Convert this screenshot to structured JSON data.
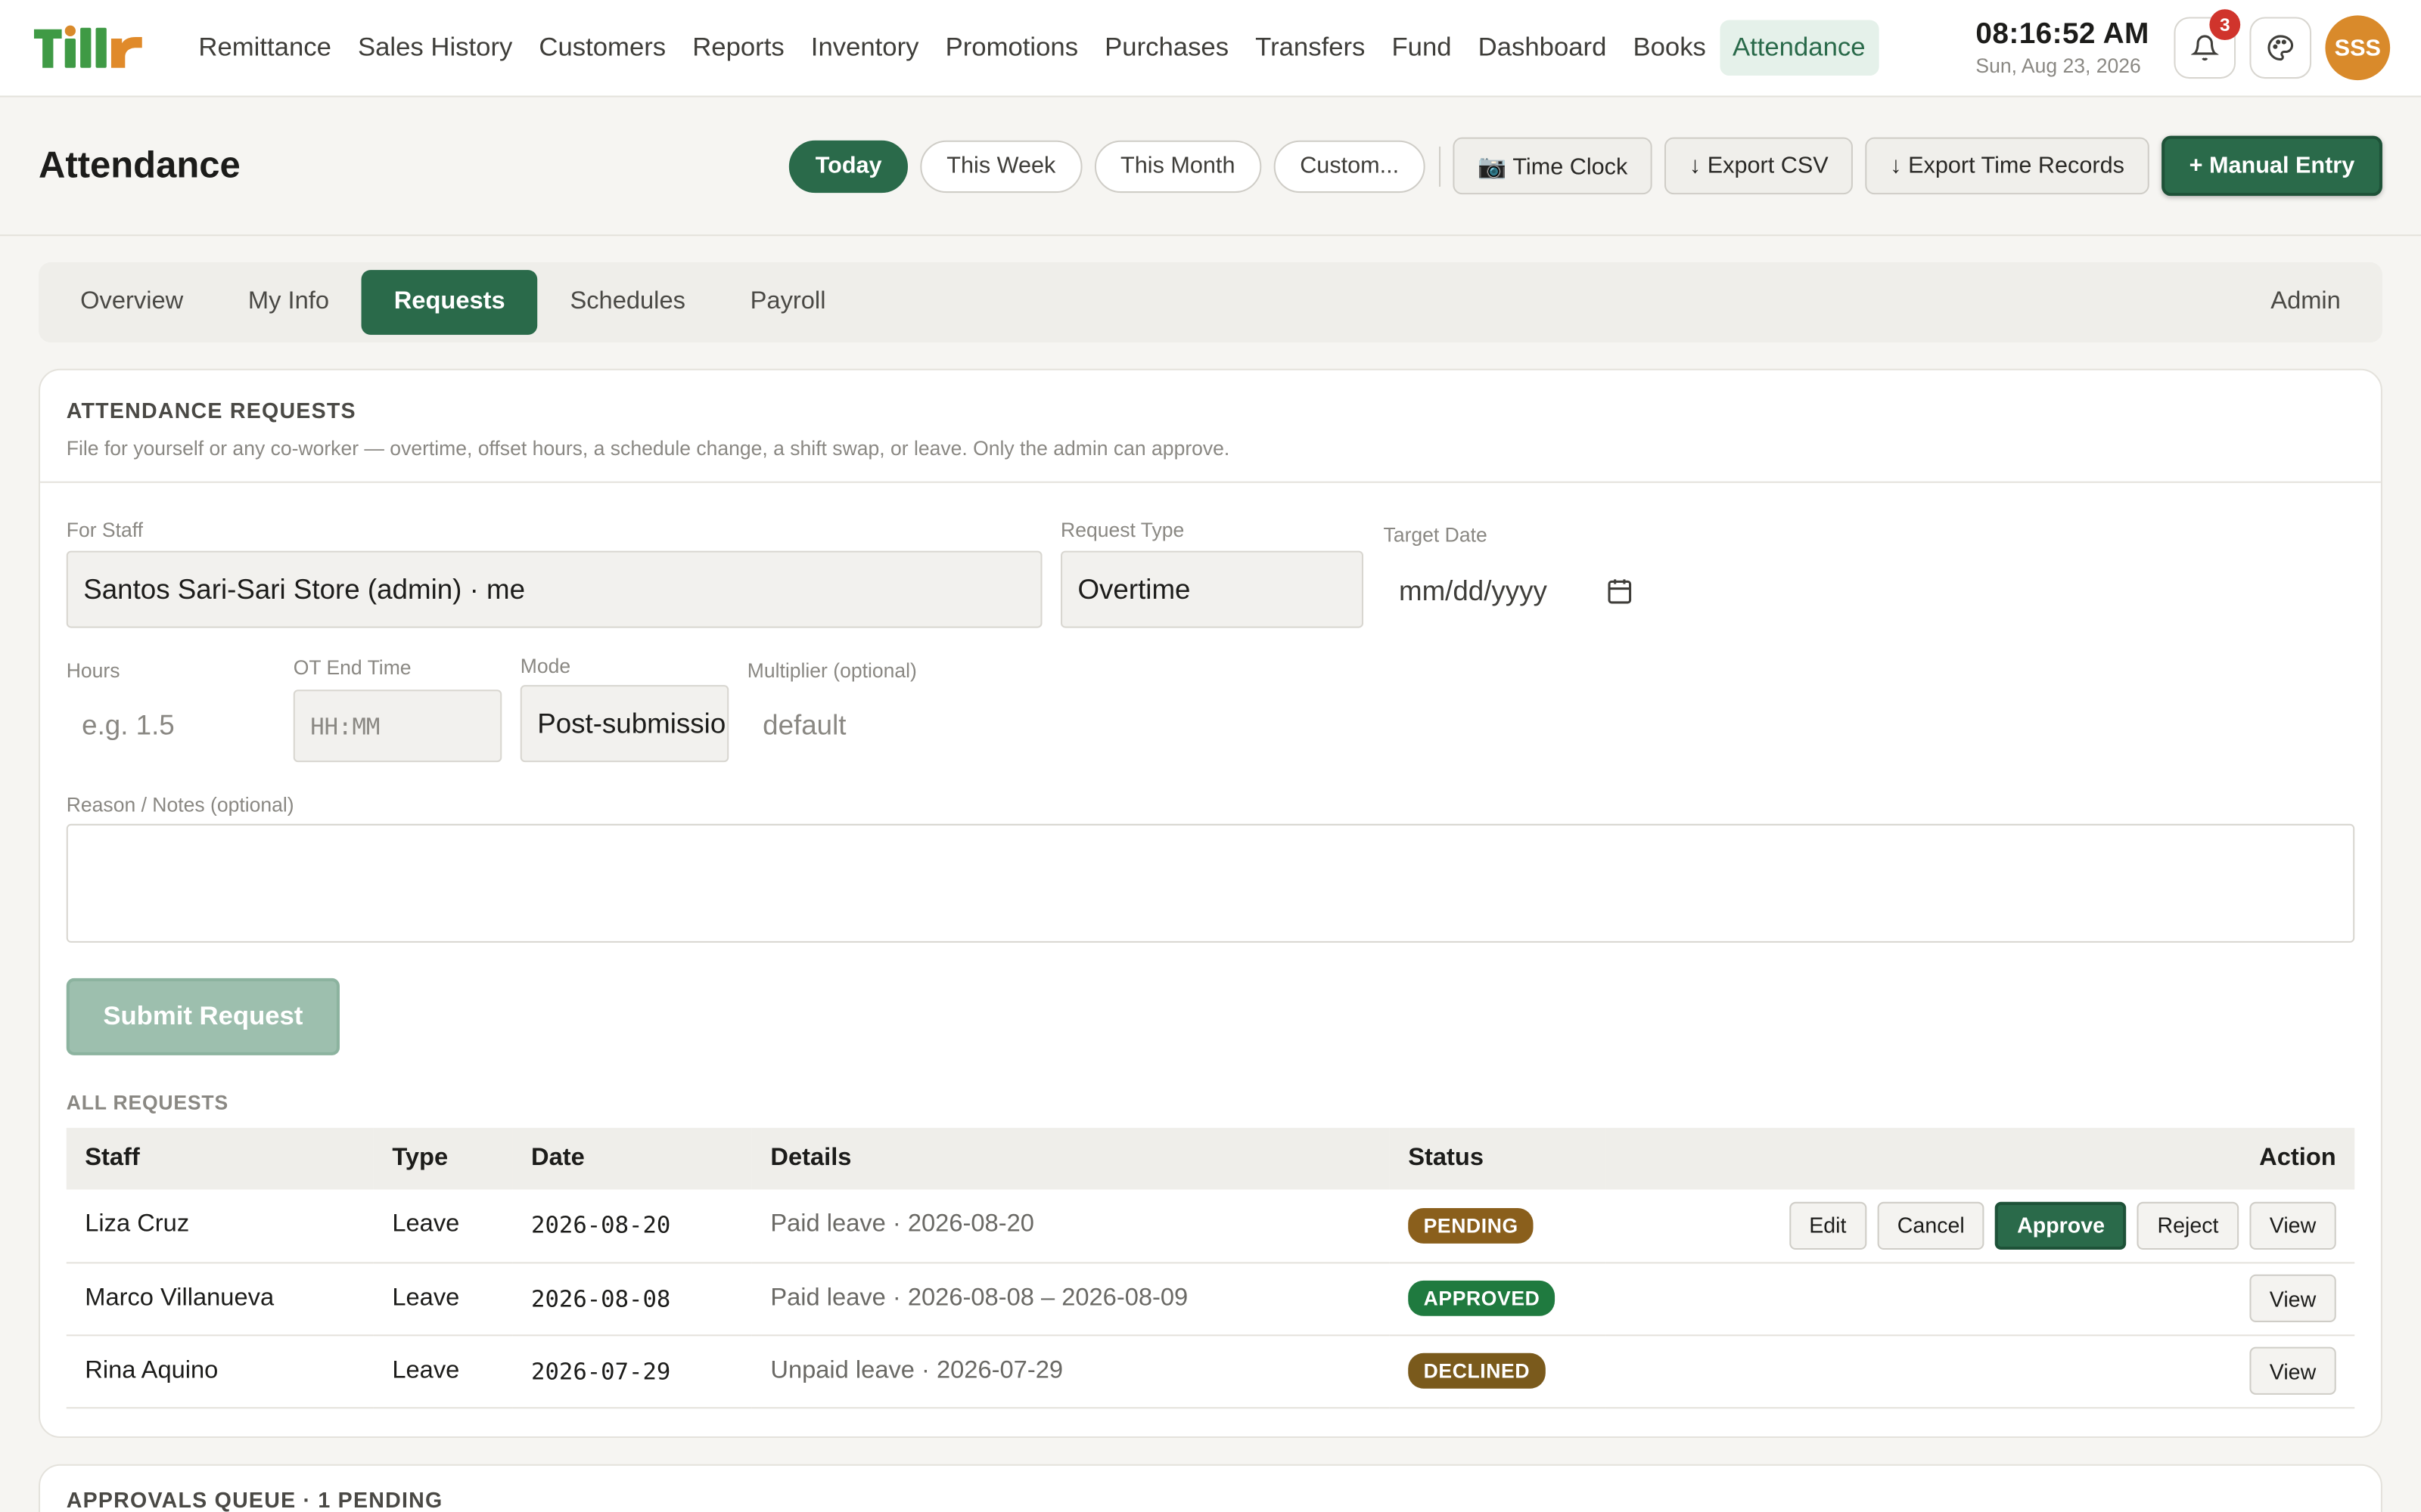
{
  "app": {
    "logo_text": "Tillr",
    "brand_colors": {
      "green": "#2a6a4a",
      "orange": "#d98a2b"
    }
  },
  "nav": {
    "items": [
      "Remittance",
      "Sales History",
      "Customers",
      "Reports",
      "Inventory",
      "Promotions",
      "Purchases",
      "Transfers",
      "Fund",
      "Dashboard",
      "Books",
      "Attendance"
    ],
    "active": "Attendance"
  },
  "clock": {
    "time": "08:16:52 AM",
    "date": "Sun, Aug 23, 2026"
  },
  "notifications": {
    "icon": "bell-icon",
    "count": "3"
  },
  "theme": {
    "icon": "palette-icon"
  },
  "user": {
    "initials": "SSS"
  },
  "header": {
    "title": "Attendance",
    "ranges": [
      "Today",
      "This Week",
      "This Month",
      "Custom..."
    ],
    "active_range": "Today",
    "time_clock": "📷 Time Clock",
    "export_csv": "↓ Export CSV",
    "export_time_records": "↓ Export Time Records",
    "manual_entry": "+ Manual Entry"
  },
  "tabs": {
    "items": [
      "Overview",
      "My Info",
      "Requests",
      "Schedules",
      "Payroll"
    ],
    "active": "Requests",
    "role": "Admin"
  },
  "requests": {
    "title": "ATTENDANCE REQUESTS",
    "subtitle": "File for yourself or any co-worker — overtime, offset hours, a schedule change, a shift swap, or leave. Only the admin can approve.",
    "form": {
      "for_staff_label": "For Staff",
      "for_staff_value": "Santos Sari-Sari Store (admin) · me",
      "request_type_label": "Request Type",
      "request_type_value": "Overtime",
      "target_date_label": "Target Date",
      "target_date_placeholder": "mm/dd/yyyy",
      "hours_label": "Hours",
      "hours_placeholder": "e.g. 1.5",
      "ot_end_label": "OT End Time",
      "ot_end_placeholder": "HH:MM",
      "mode_label": "Mode",
      "mode_value": "Post-submission",
      "multiplier_label": "Multiplier (optional)",
      "multiplier_placeholder": "default",
      "reason_label": "Reason / Notes (optional)",
      "reason_value": "",
      "submit_label": "Submit Request"
    },
    "all_requests_label": "ALL REQUESTS",
    "columns": [
      "Staff",
      "Type",
      "Date",
      "Details",
      "Status",
      "Action"
    ],
    "rows": [
      {
        "staff": "Liza Cruz",
        "type": "Leave",
        "date": "2026-08-20",
        "details": "Paid leave · 2026-08-20",
        "status": "PENDING",
        "status_color": "#8a5f1c",
        "actions": [
          "Edit",
          "Cancel",
          "Approve",
          "Reject",
          "View"
        ]
      },
      {
        "staff": "Marco Villanueva",
        "type": "Leave",
        "date": "2026-08-08",
        "details": "Paid leave · 2026-08-08 – 2026-08-09",
        "status": "APPROVED",
        "status_color": "#1f7a3f",
        "actions": [
          "View"
        ]
      },
      {
        "staff": "Rina Aquino",
        "type": "Leave",
        "date": "2026-07-29",
        "details": "Unpaid leave · 2026-07-29",
        "status": "DECLINED",
        "status_color": "#7a5a1c",
        "actions": [
          "View"
        ]
      }
    ]
  },
  "approvals": {
    "title": "APPROVALS QUEUE · 1 PENDING"
  }
}
